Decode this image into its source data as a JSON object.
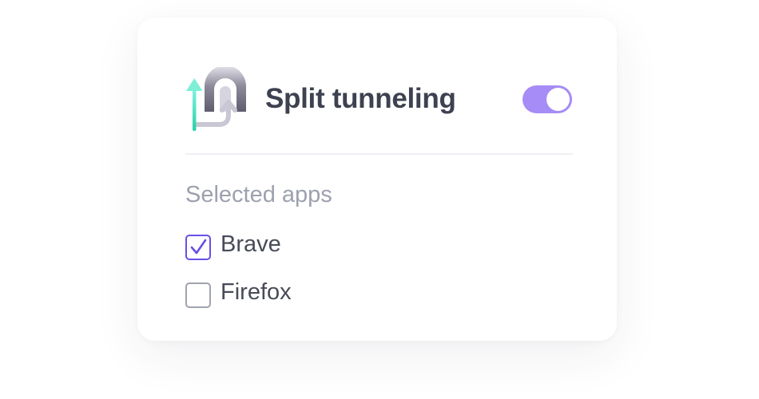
{
  "settings": {
    "title": "Split tunneling",
    "toggle_enabled": true
  },
  "selected_apps": {
    "label": "Selected apps",
    "apps": [
      {
        "name": "Brave",
        "checked": true
      },
      {
        "name": "Firefox",
        "checked": false
      }
    ]
  },
  "colors": {
    "toggle_on": "#a68cf6",
    "checkbox_checked": "#6a4fe6",
    "icon_arrow_teal": "#3be0c0",
    "icon_tunnel_gray": "#7a7888"
  }
}
